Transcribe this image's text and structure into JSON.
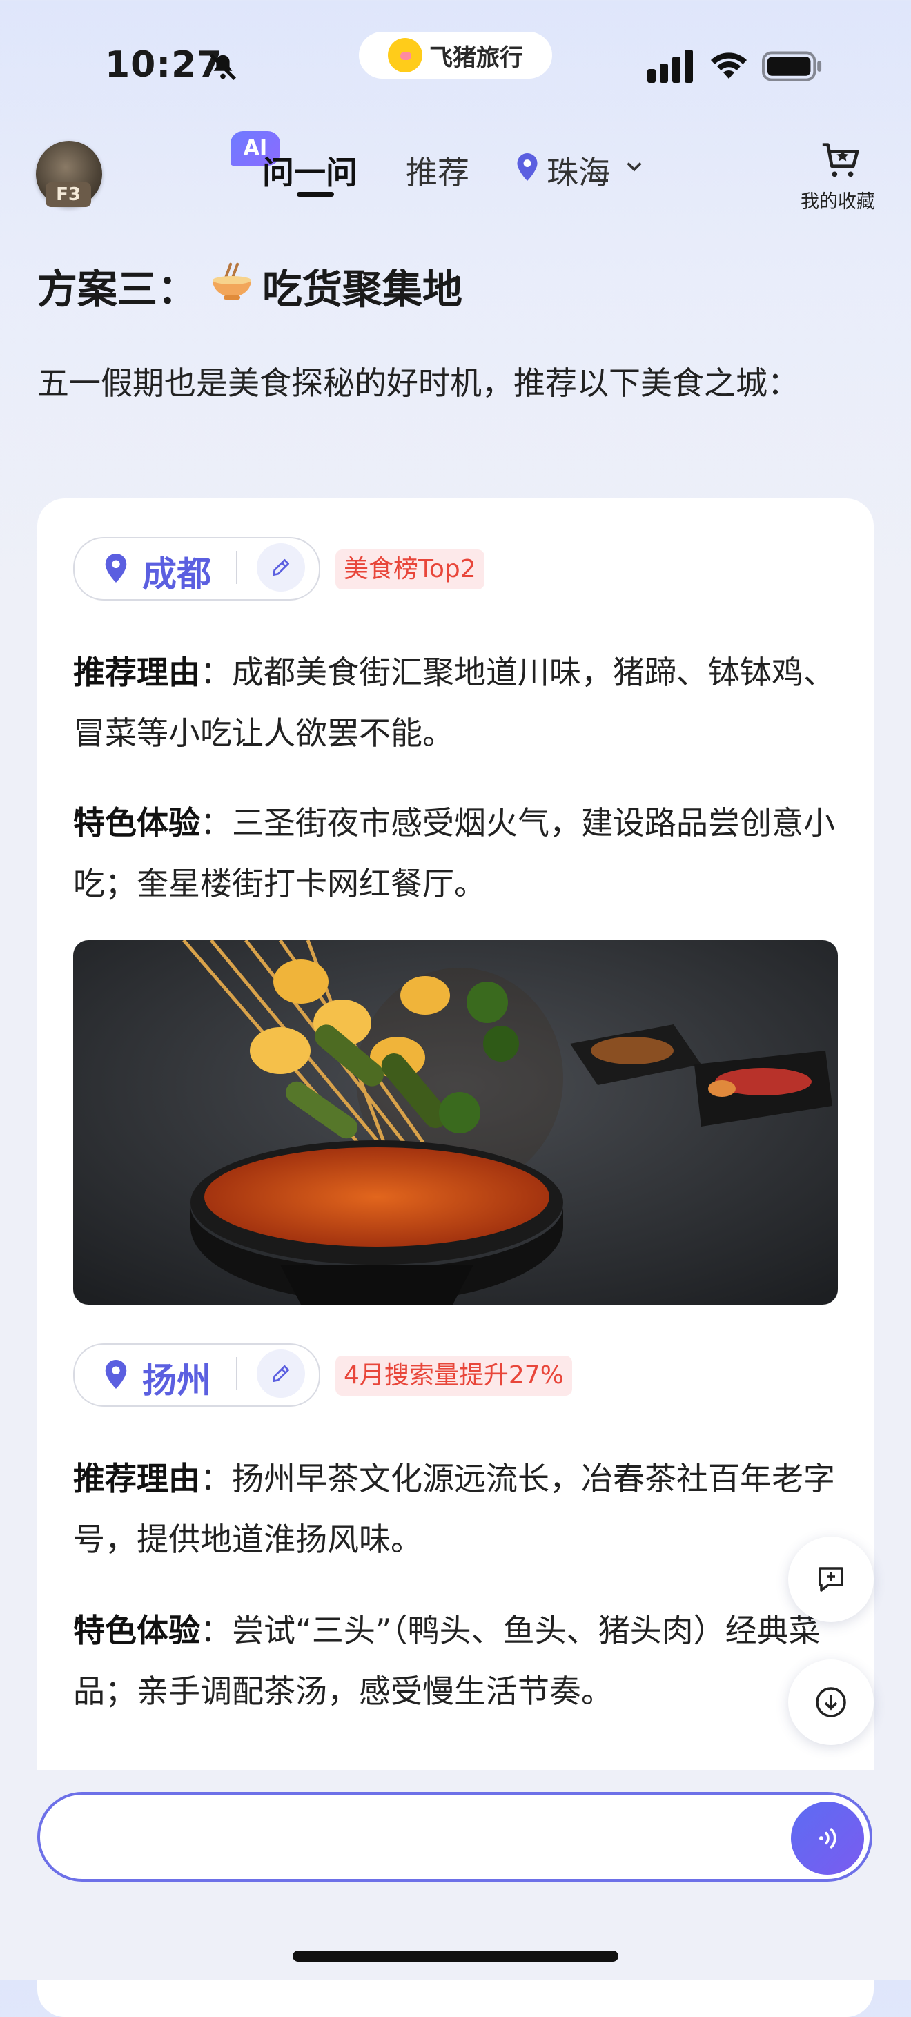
{
  "status_bar": {
    "time": "10:27",
    "app_name": "飞猪旅行"
  },
  "header": {
    "avatar_label": "F3",
    "ai_badge": "AI",
    "tab_ask": "问一问",
    "tab_recommend": "推荐",
    "city": "珠海",
    "favorites_label": "我的收藏"
  },
  "plan": {
    "title_prefix": "方案三：",
    "title_suffix": "吃货聚集地",
    "intro": "五一假期也是美食探秘的好时机，推荐以下美食之城："
  },
  "cities": [
    {
      "name": "成都",
      "tag": "美食榜Top2",
      "reason_label": "推荐理由",
      "reason": "：成都美食街汇聚地道川味，猪蹄、钵钵鸡、冒菜等小吃让人欲罢不能。",
      "experience_label": "特色体验",
      "experience": "：三圣街夜市感受烟火气，建设路品尝创意小吃；奎星楼街打卡网红餐厅。"
    },
    {
      "name": "扬州",
      "tag": "4月搜索量提升27%",
      "reason_label": "推荐理由",
      "reason": "：扬州早茶文化源远流长，冶春茶社百年老字号，提供地道淮扬风味。",
      "experience_label": "特色体验",
      "experience": "：尝试“三头”（鸭头、鱼头、猪头肉）经典菜品；亲手调配茶汤，感受慢生活节奏。"
    }
  ],
  "input": {
    "placeholder": ""
  },
  "colors": {
    "accent": "#5b5fe0",
    "tag_text": "#e8463a",
    "tag_bg": "#fde9ea",
    "input_border": "#6d70e8"
  },
  "icons": [
    "bell-off-icon",
    "signal-icon",
    "wifi-icon",
    "battery-icon",
    "location-pin-icon",
    "chevron-down-icon",
    "favorites-cart-icon",
    "edit-pencil-icon",
    "new-chat-icon",
    "scroll-down-icon",
    "voice-icon"
  ]
}
